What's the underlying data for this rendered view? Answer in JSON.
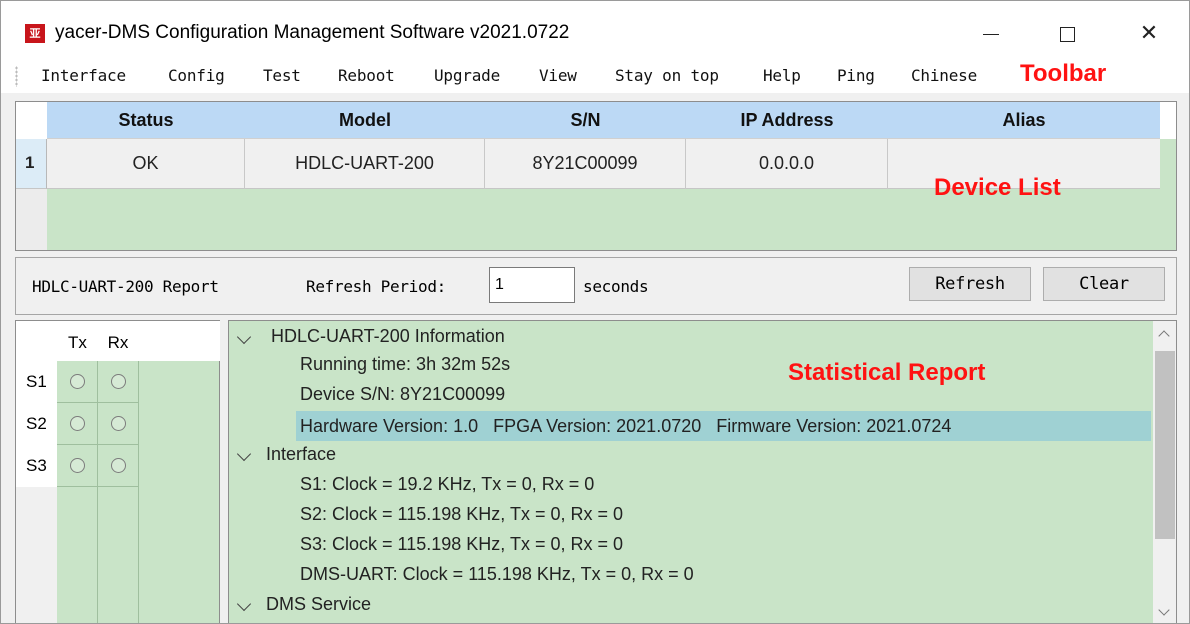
{
  "window": {
    "app_icon_text": "亚",
    "title": "yacer-DMS Configuration Management Software v2021.0722"
  },
  "menubar": {
    "items": [
      "Interface",
      "Config",
      "Test",
      "Reboot",
      "Upgrade",
      "View",
      "Stay on top",
      "Help",
      "Ping",
      "Chinese"
    ]
  },
  "annotations": {
    "toolbar": "Toolbar",
    "device_list": "Device List",
    "statistical_report": "Statistical Report"
  },
  "device_table": {
    "headers": [
      "Status",
      "Model",
      "S/N",
      "IP Address",
      "Alias"
    ],
    "rows": [
      {
        "num": "1",
        "status": "OK",
        "model": "HDLC-UART-200",
        "sn": "8Y21C00099",
        "ip": "0.0.0.0",
        "alias": ""
      }
    ]
  },
  "report_bar": {
    "report_label": "HDLC-UART-200 Report",
    "refresh_period_label": "Refresh Period:",
    "refresh_period_value": "1",
    "seconds_label": "seconds",
    "refresh_button": "Refresh",
    "clear_button": "Clear"
  },
  "led_panel": {
    "columns": [
      "Tx",
      "Rx"
    ],
    "rows": [
      "S1",
      "S2",
      "S3"
    ]
  },
  "tree": {
    "info_header": "HDLC-UART-200 Information",
    "running_time": "Running time: 3h 32m 52s",
    "device_sn": "Device S/N: 8Y21C00099",
    "versions": "Hardware Version: 1.0   FPGA Version: 2021.0720   Firmware Version: 2021.0724",
    "interface_header": "Interface",
    "s1": "S1: Clock = 19.2 KHz, Tx = 0, Rx = 0",
    "s2": "S2: Clock = 115.198 KHz, Tx = 0, Rx = 0",
    "s3": "S3: Clock = 115.198 KHz, Tx = 0, Rx = 0",
    "dms_uart": "DMS-UART: Clock = 115.198 KHz, Tx = 0, Rx = 0",
    "dms_service_header": "DMS Service"
  },
  "colors": {
    "panel_green": "#c9e4c8",
    "header_blue": "#bcd9f5",
    "selection": "#9fd1d3",
    "annotation_red": "#ff1212",
    "icon_red": "#c8151b"
  }
}
